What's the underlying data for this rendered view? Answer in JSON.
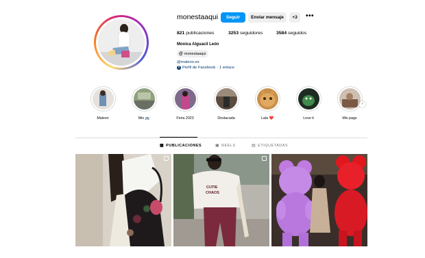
{
  "profile": {
    "username": "monestaaqui",
    "follow_label": "Seguir",
    "message_label": "Enviar mensaje",
    "suggest_icon": "+ʡ",
    "more_icon": "•••",
    "posts_count": "821",
    "posts_label": "publicaciones",
    "followers_count": "3253",
    "followers_label": "seguidores",
    "following_count": "3584",
    "following_label": "seguidos",
    "full_name": "Monica Alguacil León",
    "threads_label": "monestaaqui",
    "website": "@maleon.es",
    "facebook_link": "Perfil de Facebook",
    "extra_links": "· 1 enlace"
  },
  "highlights": [
    {
      "label": "Maleon"
    },
    {
      "label": "Mis 🚌"
    },
    {
      "label": "Feria 2023"
    },
    {
      "label": "Destacada"
    },
    {
      "label": "Lala ❤️"
    },
    {
      "label": "Love it"
    },
    {
      "label": "Mis pags"
    }
  ],
  "tabs": {
    "posts": "PUBLICACIONES",
    "reels": "REELS",
    "tagged": "ETIQUETADAS"
  },
  "posts": [
    {
      "badge_icon": "carousel-icon"
    },
    {
      "badge_icon": "carousel-icon",
      "shirt_text": "CUTIE CHAOS"
    },
    {
      "badge_icon": "none"
    }
  ],
  "colors": {
    "accent": "#0095f6",
    "link": "#00376b",
    "secondary_button": "#efefef",
    "border": "#dbdbdb"
  }
}
